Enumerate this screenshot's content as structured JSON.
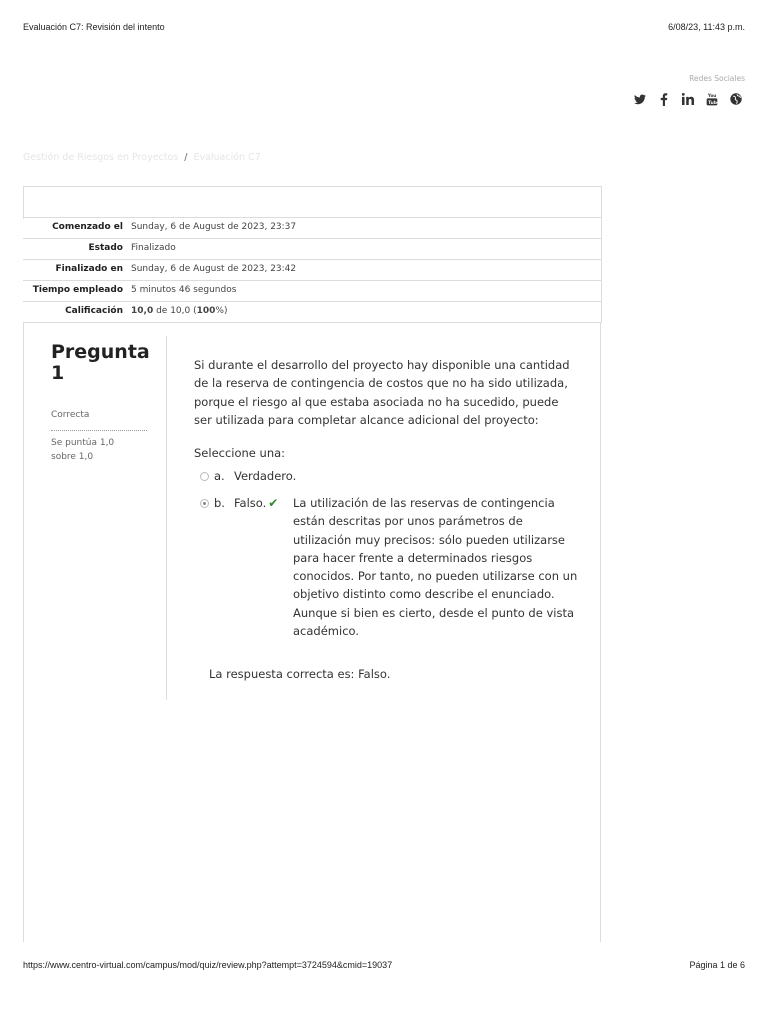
{
  "print_header": {
    "title": "Evaluación C7: Revisión del intento",
    "datetime": "6/08/23, 11:43 p.m."
  },
  "social": {
    "label": "Redes Sociales",
    "icons": [
      "twitter-icon",
      "facebook-icon",
      "linkedin-icon",
      "youtube-icon",
      "globe-icon"
    ]
  },
  "breadcrumb": {
    "course": "Gestión de Riesgos en Proyectos",
    "separator": "/",
    "page": "Evaluación C7"
  },
  "summary": [
    {
      "label": "Comenzado el",
      "value": "Sunday, 6 de August de 2023, 23:37"
    },
    {
      "label": "Estado",
      "value": "Finalizado"
    },
    {
      "label": "Finalizado en",
      "value": "Sunday, 6 de August de 2023, 23:42"
    },
    {
      "label": "Tiempo empleado",
      "value": "5 minutos 46 segundos"
    },
    {
      "label": "Calificación",
      "value_bold": "10,0",
      "value_mid": " de 10,0 (",
      "value_pct": "100",
      "value_end": "%)"
    }
  ],
  "question": {
    "title": "Pregunta 1",
    "state": "Correcta",
    "grade": "Se puntúa 1,0 sobre 1,0",
    "text": "Si durante el desarrollo del proyecto hay disponible una cantidad de la reserva de contingencia de costos que no ha sido utilizada, porque el riesgo al que estaba asociada no ha sucedido, puede ser utilizada para completar alcance adicional del proyecto:",
    "prompt": "Seleccione una:",
    "options": [
      {
        "letter": "a.",
        "label": "Verdadero.",
        "selected": false
      },
      {
        "letter": "b.",
        "label": "Falso.",
        "selected": true,
        "correct_mark": "✔"
      }
    ],
    "feedback": "La utilización de las reservas de contingencia están descritas por unos parámetros de utilización muy precisos: sólo pueden utilizarse para hacer frente a determinados riesgos conocidos. Por tanto, no pueden utilizarse con un objetivo distinto como describe el enunciado. Aunque si bien es cierto, desde el punto de vista académico.",
    "right_answer": "La respuesta correcta es: Falso."
  },
  "footer": {
    "url": "https://www.centro-virtual.com/campus/mod/quiz/review.php?attempt=3724594&cmid=19037",
    "page": "Página 1 de 6"
  }
}
